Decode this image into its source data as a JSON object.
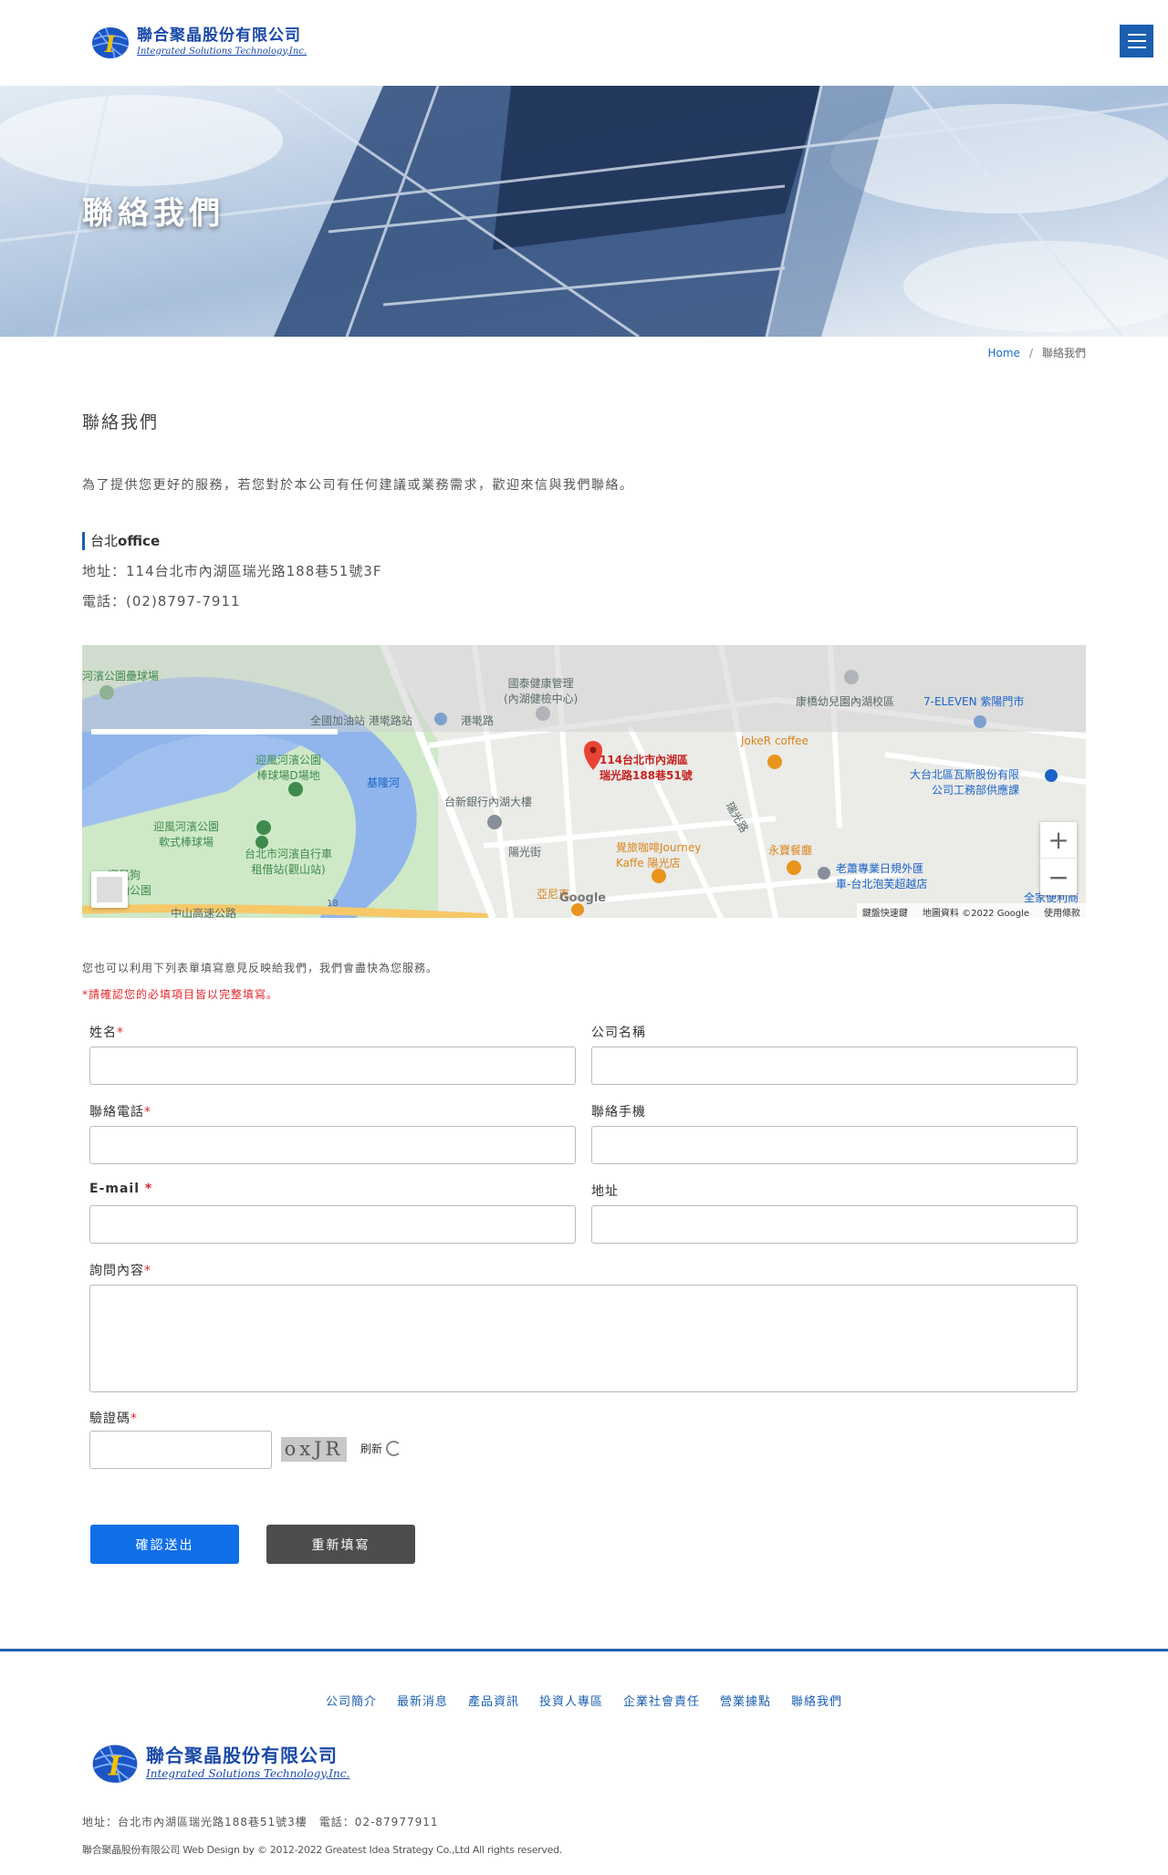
{
  "header": {
    "logo_cn": "聯合聚晶股份有限公司",
    "logo_en": "Integrated Solutions Technology,Inc.",
    "menu_icon": "hamburger-menu-icon",
    "brand_color": "#1a5fb0"
  },
  "banner": {
    "title": "聯絡我們"
  },
  "breadcrumb": {
    "home": "Home",
    "separator": "/",
    "current": "聯絡我們"
  },
  "page": {
    "heading": "聯絡我們",
    "intro": "為了提供您更好的服務，若您對於本公司有任何建議或業務需求，歡迎來信與我們聯絡。"
  },
  "office": {
    "title_prefix": "台北",
    "title_bold": "office",
    "address": "地址：114台北市內湖區瑞光路188巷51號3F",
    "phone": "電話：(02)8797-7911"
  },
  "map": {
    "labels": {
      "park_baseball": "河濱公園壘球場",
      "health": "國泰健康管理\n(內湖健檢中心)",
      "kindergarten": "康橋幼兒園內湖校區",
      "seven": "7-ELEVEN 紫陽門市",
      "gas": "全國加油站 港墘路站",
      "road_gangqian": "港墘路",
      "pin": "114台北市內湖區\n瑞光路188巷51號",
      "joker": "JokeR coffee",
      "gasco": "大台北區瓦斯股份有限\n公司工務部供應課",
      "river": "基隆河",
      "softball": "迎風河濱公園\n棒球場D場地",
      "taishin": "台新銀行內湖大樓",
      "yingfeng": "迎風河濱公園\n軟式棒球場",
      "bike": "台北市河濱自行車\n租借站(觀山站)",
      "coffee": "覺旅咖啡Journey\nKaffe 陽光店",
      "yongbao": "永寶餐廳",
      "laoxiao": "老蕭專業日規外匯\n車-台北泡芙超越店",
      "dog": "迎風狗\n運動公園",
      "yangguang": "陽光街",
      "highway": "中山高速公路",
      "yani": "亞尼克",
      "quanjia": "全家便利商",
      "jiuyuan": "瑞光路",
      "highway_num": "18"
    },
    "google": "Google",
    "footer": [
      "鍵盤快速鍵",
      "地圖資料 ©2022 Google",
      "使用條款"
    ],
    "zoom_in": "+",
    "zoom_out": "−"
  },
  "form": {
    "intro": "您也可以利用下列表單填寫意見反映給我們，我們會盡快為您服務。",
    "warning": "*請確認您的必填項目皆以完整填寫。",
    "required_mark": "*",
    "labels": {
      "name": "姓名",
      "company": "公司名稱",
      "phone": "聯絡電話",
      "mobile": "聯絡手機",
      "email": "E-mail ",
      "address": "地址",
      "message": "詢問內容",
      "captcha": "驗證碼"
    },
    "values": {
      "name": "",
      "company": "",
      "phone": "",
      "mobile": "",
      "email": "",
      "address": "",
      "message": "",
      "captcha": ""
    },
    "captcha_text": "oxJR",
    "refresh_label": "刷新",
    "submit_label": "確認送出",
    "reset_label": "重新填寫",
    "submit_color": "#0f6fe8",
    "reset_color": "#4d4d4d"
  },
  "footer": {
    "nav": [
      "公司簡介",
      "最新消息",
      "產品資訊",
      "投資人專區",
      "企業社會責任",
      "營業據點",
      "聯絡我們"
    ],
    "logo_cn": "聯合聚晶股份有限公司",
    "logo_en": "Integrated Solutions Technology,Inc.",
    "address": "地址：台北市內湖區瑞光路188巷51號3樓　電話：02-87977911",
    "copyright": "聯合聚晶股份有限公司 Web Design by © 2012-2022 Greatest Idea Strategy Co.,Ltd All rights reserved."
  }
}
